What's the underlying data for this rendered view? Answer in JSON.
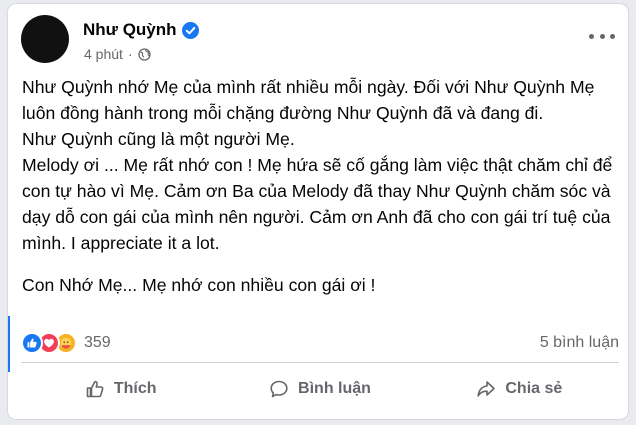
{
  "post": {
    "author_name": "Như Quỳnh",
    "time": "4 phút",
    "separator": "·",
    "paragraphs": [
      "Như Quỳnh nhớ Mẹ của mình rất nhiều mỗi ngày. Đối với Như Quỳnh Mẹ luôn đồng hành trong mỗi chặng đường Như Quỳnh đã và đang đi.",
      "Như Quỳnh cũng là một người Mẹ.",
      "Melody ơi ... Mẹ rất nhớ con ! Mẹ hứa sẽ cố gắng làm việc thật chăm chỉ để con tự hào vì Mẹ. Cảm ơn Ba của Melody đã thay Như Quỳnh chăm sóc và dạy dỗ con gái của mình nên người.  Cảm ơn Anh đã cho con gái trí tuệ của mình. I appreciate it a lot.",
      "Con Nhớ Mẹ... Mẹ nhớ con nhiều con gái ơi !"
    ]
  },
  "stats": {
    "reaction_icons": [
      "like-icon",
      "love-icon",
      "care-icon"
    ],
    "reaction_count": "359",
    "comment_count": "5 bình luận"
  },
  "actions": {
    "like_label": "Thích",
    "comment_label": "Bình luận",
    "share_label": "Chia sẻ"
  },
  "colors": {
    "accent": "#1877f2",
    "love": "#f33e58",
    "care": "#f7b125",
    "secondary_text": "#65676b"
  }
}
